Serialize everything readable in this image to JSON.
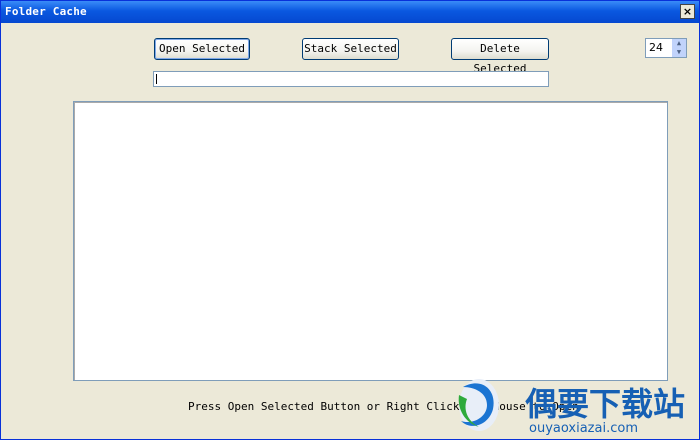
{
  "window": {
    "title": "Folder Cache",
    "close_glyph": "×"
  },
  "toolbar": {
    "open_selected": "Open Selected",
    "stack_selected": "Stack Selected",
    "delete_selected": "Delete Selected"
  },
  "spinner": {
    "value": "24",
    "up_glyph": "▲",
    "down_glyph": "▼"
  },
  "path_field": {
    "value": ""
  },
  "listbox": {
    "items": []
  },
  "status": {
    "text": "Press Open Selected Button or Right Click the Mouse to Open"
  },
  "watermark": {
    "chinese": "偶要下载站",
    "url": "ouyaoxiazai.com",
    "icon": "logo-icon"
  },
  "colors": {
    "titlebar": "#0a58e0",
    "window_bg": "#ece9d8",
    "field_border": "#7f9db9",
    "watermark": "#1660b4"
  }
}
